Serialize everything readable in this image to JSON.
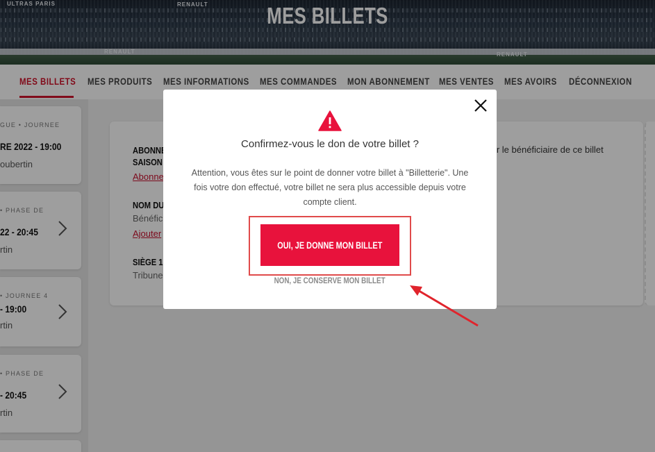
{
  "header": {
    "title": "MES BILLETS",
    "banner_texts": [
      "ULTRAS PARIS",
      "RENAULT",
      "RENAULT",
      "RENAULT"
    ]
  },
  "nav": {
    "items": [
      {
        "label": "MES BILLETS",
        "active": true
      },
      {
        "label": "MES PRODUITS"
      },
      {
        "label": "MES INFORMATIONS"
      },
      {
        "label": "MES COMMANDES"
      },
      {
        "label": "MON ABONNEMENT"
      },
      {
        "label": "MES VENTES"
      },
      {
        "label": "MES AVOIRS"
      },
      {
        "label": "DÉCONNEXION"
      }
    ]
  },
  "tickets": [
    {
      "line1": "GUE • JOURNEE",
      "line2": "RE 2022 - 19:00",
      "line3": "oubertin"
    },
    {
      "line1": "• PHASE DE",
      "line2": "22 - 20:45",
      "line3": "rtin"
    },
    {
      "line1": "• JOURNEE 4",
      "line2": "- 19:00",
      "line3": "rtin"
    },
    {
      "line1": "• PHASE DE",
      "line2": "- 20:45",
      "line3": "rtin"
    }
  ],
  "main_card": {
    "abonnement_label_1": "ABONNE",
    "abonnement_label_2": "SAISON",
    "abonnement_link": "Abonne",
    "nom_label": "NOM DU",
    "nom_sub": "Bénéfic",
    "nom_link": "Ajouter",
    "siege_label": "SIÈGE 1",
    "siege_sub": "Tribune",
    "right_text": "ter le bénéficiaire de ce billet"
  },
  "modal": {
    "title": "Confirmez-vous le don de votre billet ?",
    "body": "Attention, vous êtes sur le point de donner votre billet à \"Billetterie\". Une fois votre don effectué, votre billet ne sera plus accessible depuis votre compte client.",
    "confirm_label": "OUI, JE DONNE MON BILLET",
    "cancel_label": "NON, JE CONSERVE MON BILLET"
  },
  "colors": {
    "accent": "#e8123c",
    "nav_active": "#d0142c",
    "annotation": "#e04a4a"
  },
  "icons": [
    "warning-icon",
    "close-icon",
    "chevron-right-icon"
  ]
}
